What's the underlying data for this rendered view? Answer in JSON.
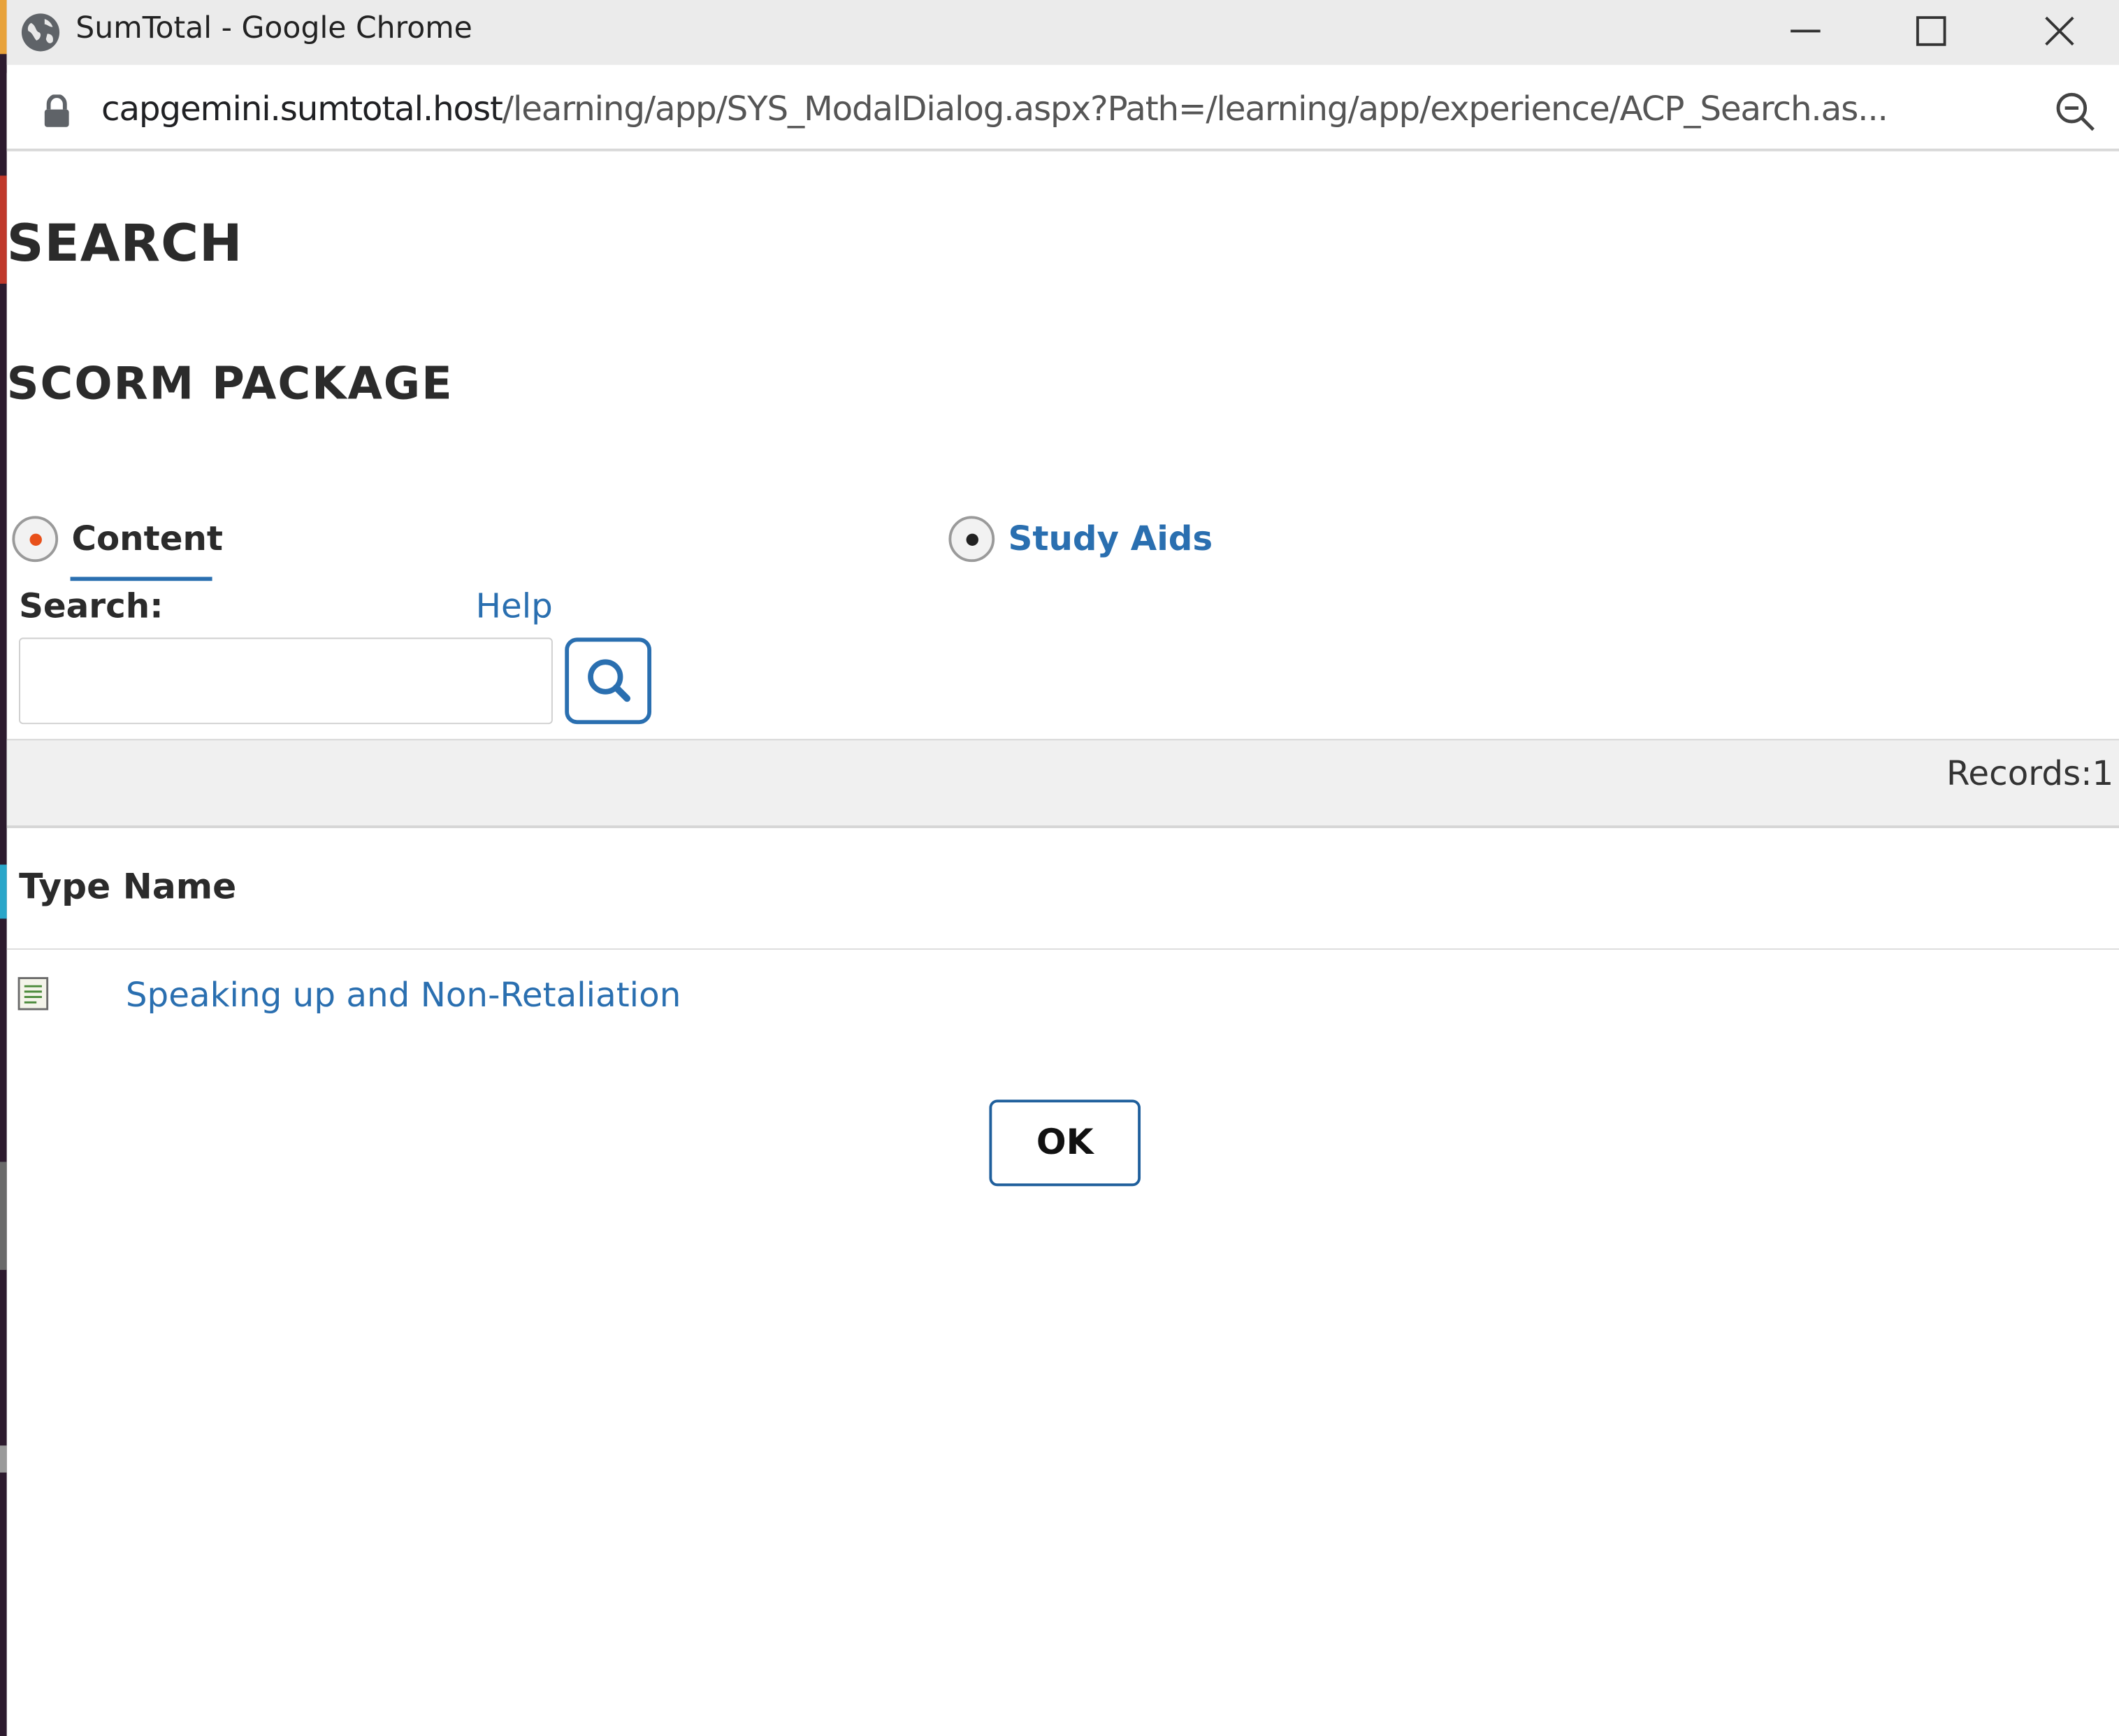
{
  "window": {
    "title": "SumTotal - Google Chrome"
  },
  "address_bar": {
    "url_host": "capgemini.sumtotal.host",
    "url_path": "/learning/app/SYS_ModalDialog.aspx?Path=/learning/app/experience/ACP_Search.as..."
  },
  "page": {
    "heading": "SEARCH",
    "subheading": "SCORM PACKAGE"
  },
  "tabs": [
    {
      "label": "Content",
      "selected": true
    },
    {
      "label": "Study Aids",
      "selected": false
    }
  ],
  "search": {
    "label": "Search:",
    "help_label": "Help",
    "value": "",
    "placeholder": ""
  },
  "results": {
    "records_label": "Records:1",
    "column_header": "Type Name",
    "rows": [
      {
        "name": "Speaking up and Non-Retaliation",
        "type_icon": "document-icon"
      }
    ]
  },
  "footer": {
    "ok_label": "OK"
  },
  "colors": {
    "link": "#2a6fb0",
    "selected_dot": "#e8501a",
    "tab_underline": "#2a6fb0"
  }
}
